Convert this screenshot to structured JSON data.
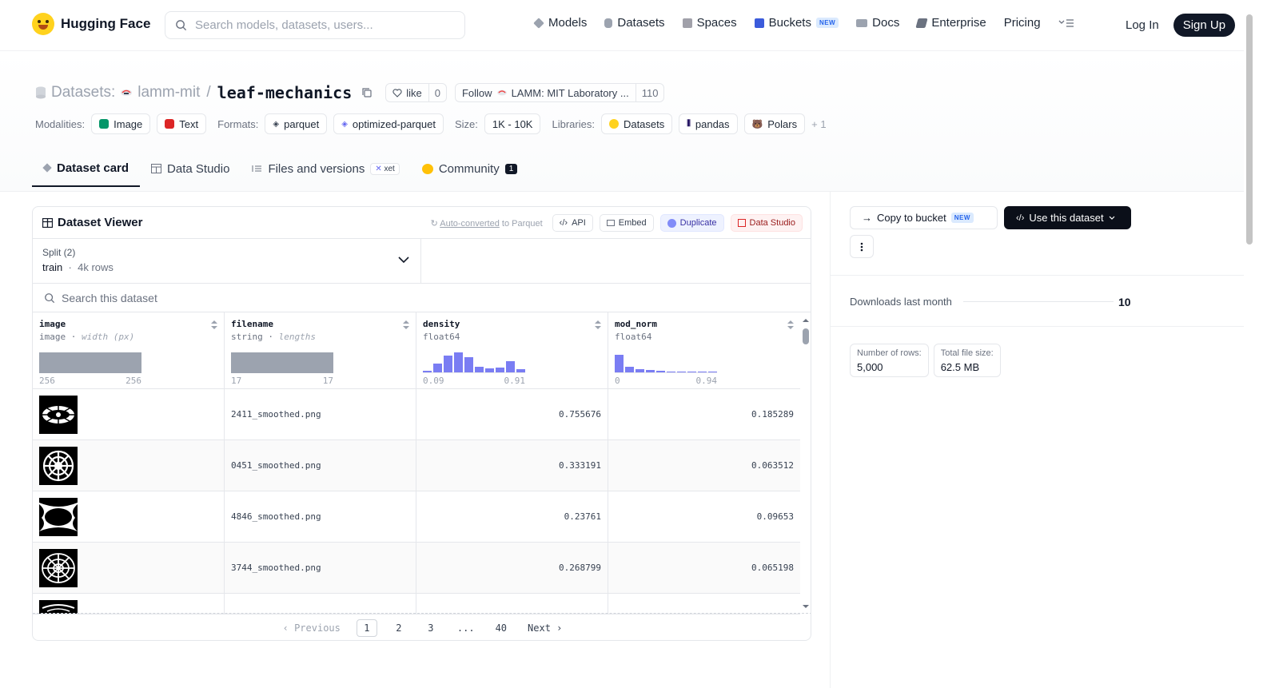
{
  "nav": {
    "brand": "Hugging Face",
    "search_placeholder": "Search models, datasets, users...",
    "links": [
      {
        "label": "Models",
        "icon": "cube-icon"
      },
      {
        "label": "Datasets",
        "icon": "database-icon"
      },
      {
        "label": "Spaces",
        "icon": "grid-icon"
      },
      {
        "label": "Buckets",
        "icon": "bucket-icon",
        "badge": "NEW"
      },
      {
        "label": "Docs",
        "icon": "book-icon"
      },
      {
        "label": "Enterprise",
        "icon": "enterprise-icon"
      },
      {
        "label": "Pricing"
      }
    ],
    "login": "Log In",
    "signup": "Sign Up"
  },
  "header": {
    "prefix": "Datasets:",
    "owner": "lamm-mit",
    "repo": "leaf-mechanics",
    "like_label": "like",
    "like_count": "0",
    "follow_label": "Follow",
    "org_name": "LAMM: MIT Laboratory ...",
    "follow_count": "110",
    "modalities_label": "Modalities:",
    "modalities": [
      "Image",
      "Text"
    ],
    "formats_label": "Formats:",
    "formats": [
      "parquet",
      "optimized-parquet"
    ],
    "size_label": "Size:",
    "size": "1K - 10K",
    "libraries_label": "Libraries:",
    "libraries": [
      "Datasets",
      "pandas",
      "Polars"
    ],
    "libraries_more": "+ 1"
  },
  "tabs": [
    {
      "label": "Dataset card"
    },
    {
      "label": "Data Studio"
    },
    {
      "label": "Files and versions",
      "badge": "xet"
    },
    {
      "label": "Community",
      "count": "1"
    }
  ],
  "viewer": {
    "title": "Dataset Viewer",
    "auto_prefix": "Auto-converted",
    "auto_suffix": " to Parquet",
    "actions": [
      "API",
      "Embed",
      "Duplicate",
      "Data Studio"
    ],
    "split_label": "Split (2)",
    "split_value": "train",
    "split_rows": "4k rows",
    "search_placeholder": "Search this dataset",
    "columns": [
      {
        "name": "image",
        "type": "image",
        "sub": "width (px)",
        "min": "256",
        "max": "256"
      },
      {
        "name": "filename",
        "type": "string",
        "sub": "lengths",
        "min": "17",
        "max": "17"
      },
      {
        "name": "density",
        "type": "float64",
        "min": "0.09",
        "max": "0.91",
        "hist": [
          0.1,
          0.45,
          0.85,
          1.0,
          0.75,
          0.3,
          0.2,
          0.25,
          0.55,
          0.15
        ]
      },
      {
        "name": "mod_norm",
        "type": "float64",
        "min": "0",
        "max": "0.94",
        "hist": [
          0.9,
          0.3,
          0.15,
          0.12,
          0.08,
          0.05,
          0.04,
          0.04,
          0.03,
          0.03
        ]
      }
    ],
    "rows": [
      {
        "filename": "2411_smoothed.png",
        "density": "0.755676",
        "mod_norm": "0.185289"
      },
      {
        "filename": "0451_smoothed.png",
        "density": "0.333191",
        "mod_norm": "0.063512"
      },
      {
        "filename": "4846_smoothed.png",
        "density": "0.23761",
        "mod_norm": "0.09653"
      },
      {
        "filename": "3744_smoothed.png",
        "density": "0.268799",
        "mod_norm": "0.065198"
      }
    ],
    "pager": {
      "prev": "Previous",
      "pages": [
        "1",
        "2",
        "3",
        "...",
        "40"
      ],
      "next": "Next"
    }
  },
  "sidebar": {
    "copy_label": "Copy to bucket",
    "copy_badge": "NEW",
    "use_label": "Use this dataset",
    "downloads_label": "Downloads last month",
    "downloads_value": "10",
    "rows_label": "Number of rows:",
    "rows_value": "5,000",
    "size_label": "Total file size:",
    "size_value": "62.5 MB"
  }
}
